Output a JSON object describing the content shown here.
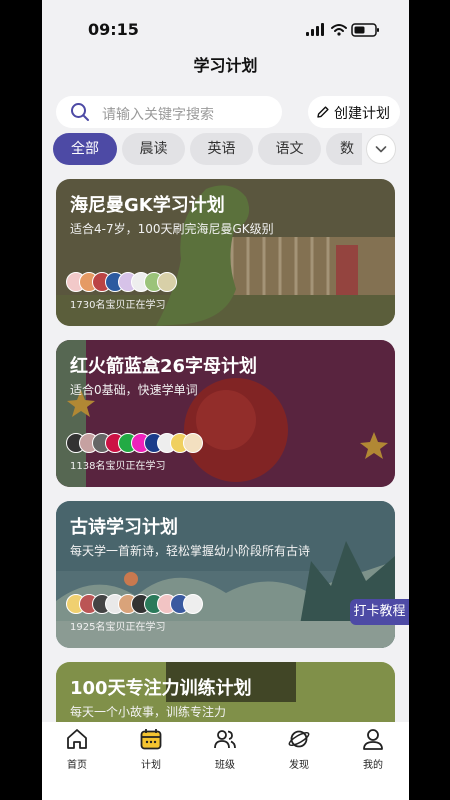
{
  "status": {
    "time": "09:15"
  },
  "header": {
    "title": "学习计划"
  },
  "search": {
    "placeholder": "请输入关键字搜索"
  },
  "create": {
    "label": "创建计划"
  },
  "tabs": [
    {
      "label": "全部",
      "active": true
    },
    {
      "label": "晨读"
    },
    {
      "label": "英语"
    },
    {
      "label": "语文"
    },
    {
      "label": "数"
    }
  ],
  "cards": [
    {
      "title": "海尼曼GK学习计划",
      "subtitle": "适合4-7岁，100天刷完海尼曼GK级别",
      "count": "1730名宝贝正在学习"
    },
    {
      "title": "红火箭蓝盒26字母计划",
      "subtitle": "适合0基础，快速学单词",
      "count": "1138名宝贝正在学习"
    },
    {
      "title": "古诗学习计划",
      "subtitle": "每天学一首新诗，轻松掌握幼小阶段所有古诗",
      "count": "1925名宝贝正在学习"
    },
    {
      "title": "100天专注力训练计划",
      "subtitle": "每天一个小故事，训练专注力"
    }
  ],
  "fab": {
    "label": "打卡教程"
  },
  "nav": [
    {
      "label": "首页",
      "icon": "home-icon"
    },
    {
      "label": "计划",
      "icon": "calendar-icon"
    },
    {
      "label": "班级",
      "icon": "people-icon"
    },
    {
      "label": "发现",
      "icon": "planet-icon"
    },
    {
      "label": "我的",
      "icon": "user-icon"
    }
  ],
  "colors": {
    "accent": "#4d4aa5",
    "page_bg": "#f1f1f3"
  }
}
